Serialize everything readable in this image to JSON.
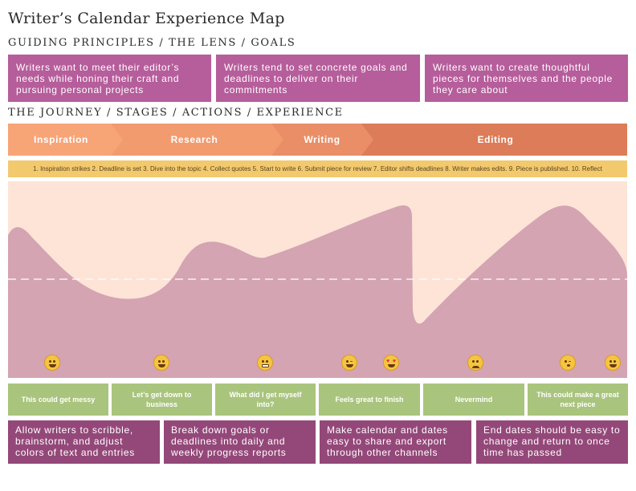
{
  "title": "Writer’s Calendar Experience Map",
  "goals_heading": "GUIDING PRINCIPLES / THE LENS / GOALS",
  "goals": [
    "Writers want to meet their editor’s needs while honing their craft and pursuing personal projects",
    "Writers tend to set concrete goals and deadlines to deliver on their commitments",
    "Writers want to create thoughtful pieces for themselves and the people they care about"
  ],
  "journey_heading": "THE JOURNEY / STAGES / ACTIONS / EXPERIENCE",
  "stages": [
    "Inspiration",
    "Research",
    "Writing",
    "Editing"
  ],
  "actions": "1. Inspiration strikes 2. Deadline is set 3. Dive into the topic 4. Collect quotes 5. Start to write 6. Submit piece for review 7. Editor shifts deadlines 8. Writer makes edits. 9. Piece is published. 10. Reflect",
  "emotions": [
    "smiling-face-icon",
    "grinning-face-icon",
    "grimacing-face-icon",
    "winking-face-icon",
    "heart-eyes-face-icon",
    "sweat-face-icon",
    "kissing-face-icon",
    "grinning-face-icon"
  ],
  "insights": [
    "This could get messy",
    "Let’s get down to business",
    "What did I get myself into?",
    "Feels great to finish",
    "Nevermind",
    "This could make a great next piece"
  ],
  "opportunities": [
    "Allow writers to scribble, brainstorm, and adjust colors of text and entries",
    "Break down goals or deadlines into daily and weekly progress reports",
    "Make calendar and dates easy to share and export through other channels",
    "End dates should be easy to change and return to once time has passed"
  ],
  "colors": {
    "goal": "#b65d9b",
    "opportunity": "#944879",
    "insight": "#a9c47d",
    "actions": "#f3c96e",
    "stage_light": "#f7a477",
    "stage_dark": "#dd7c58",
    "curve_bg": "#fde4d7",
    "curve_fill": "#d4a4b2"
  }
}
